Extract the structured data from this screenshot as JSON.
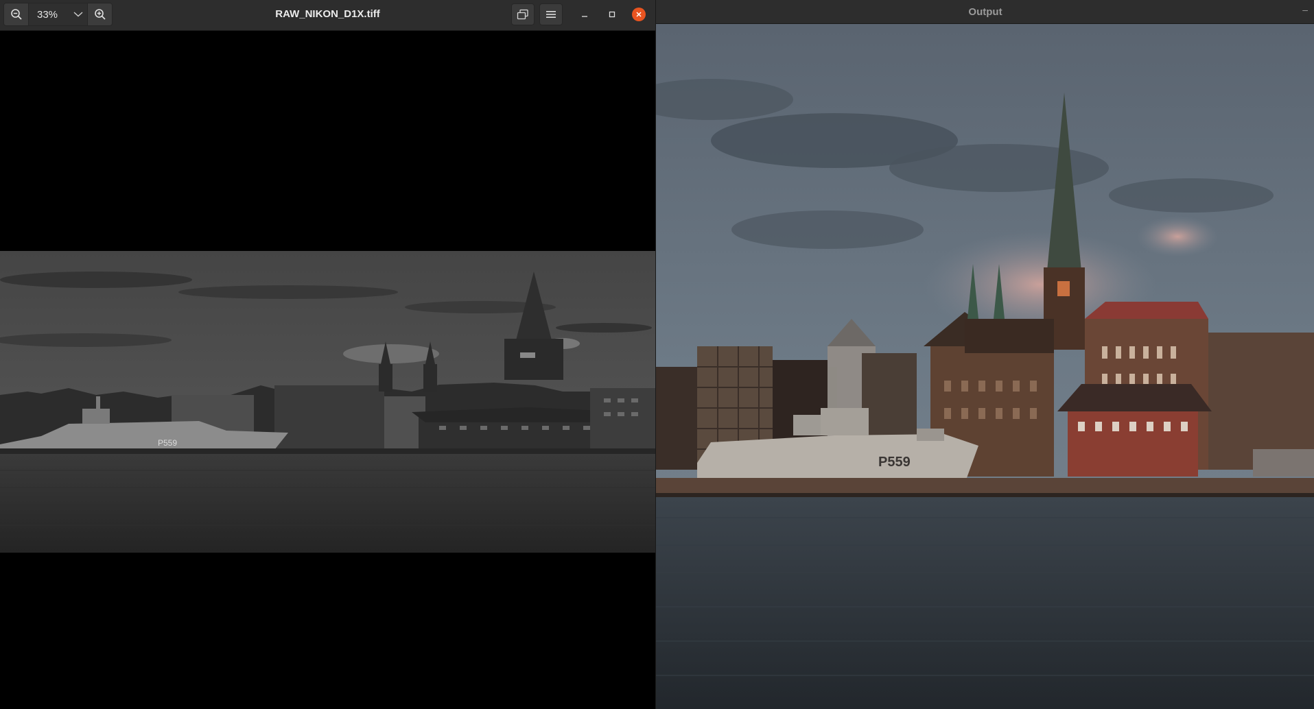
{
  "viewer": {
    "title": "RAW_NIKON_D1X.tiff",
    "zoom_value": "33%",
    "icons": {
      "zoom_out": "zoom-out-icon",
      "zoom_dropdown": "chevron-down-icon",
      "zoom_in": "zoom-in-icon",
      "rotate": "rotate-icon",
      "menu": "hamburger-menu-icon",
      "minimize": "minimize-icon",
      "maximize": "maximize-icon",
      "close": "close-icon"
    },
    "image_label": "P559"
  },
  "output": {
    "title": "Output",
    "minimize_glyph": "–",
    "image_label": "P559"
  },
  "colors": {
    "headerbar": "#2d2d2d",
    "close_button": "#e95420",
    "title_text": "#ececec",
    "output_title_text": "#9a9a9a"
  }
}
